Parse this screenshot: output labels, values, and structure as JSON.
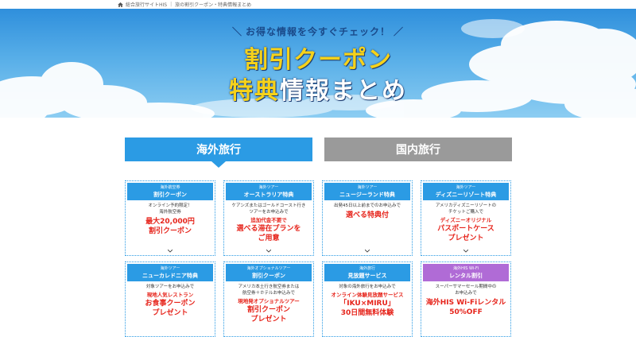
{
  "breadcrumb": {
    "home": "総合旅行サイトHIS",
    "current": "旅の割引クーポン・特典情報まとめ"
  },
  "hero": {
    "tagline": "お得な情報を今すぐチェック！",
    "title_line1": "割引クーポン",
    "title_line2_yellow": "特典",
    "title_line2_white": "情報まとめ"
  },
  "tabs": {
    "overseas": "海外旅行",
    "domestic": "国内旅行"
  },
  "cards": [
    {
      "category": "海外航空券",
      "name": "割引クーポン",
      "desc": [
        "オンライン予約限定！",
        "海外航空券"
      ],
      "highlight": [
        "最大20,000円",
        "割引クーポン"
      ]
    },
    {
      "category": "海外ツアー",
      "name": "オーストラリア特典",
      "desc": [
        "ケアンズまたはゴールドコースト行き",
        "ツアーをお申込みで"
      ],
      "highlight_small": "追加代金不要で",
      "highlight": [
        "選べる滞在プランを",
        "ご用意"
      ]
    },
    {
      "category": "海外ツアー",
      "name": "ニュージーランド特典",
      "desc": [
        "出発45日以上前までのお申込みで"
      ],
      "highlight": [
        "選べる特典付"
      ]
    },
    {
      "category": "海外ツアー",
      "name": "ディズニーリゾート特典",
      "desc": [
        "アメリカディズニーリゾートの",
        "チケットご購入で"
      ],
      "highlight_small": "ディズニーオリジナル",
      "highlight": [
        "パスポートケース",
        "プレゼント"
      ]
    },
    {
      "category": "海外ツアー",
      "name": "ニューカレドニア特典",
      "desc": [
        "対象ツアーをお申込みで"
      ],
      "highlight_small": "現地人気レストラン",
      "highlight": [
        "お食事クーポン",
        "プレゼント"
      ]
    },
    {
      "category": "海外オプショナルツアー",
      "name": "割引クーポン",
      "desc": [
        "アメリカ本土行き航空券または",
        "航空券＋ホテルお申込みで"
      ],
      "highlight_small": "現地発オプショナルツアー",
      "highlight": [
        "割引クーポン",
        "プレゼント"
      ]
    },
    {
      "category": "海外旅行",
      "name": "見放題サービス",
      "desc": [
        "対象の海外旅行をお申込みで"
      ],
      "highlight_small": "オンライン体験見放題サービス",
      "highlight": [
        "「IKU×MIRU」",
        "30日間無料体験"
      ]
    },
    {
      "category": "海外HIS Wi-Fi",
      "name": "レンタル割引",
      "desc": [
        "スーパーサマーセール期間中の",
        "お申込みで"
      ],
      "highlight": [
        "海外HIS Wi-Fiレンタル",
        "50%OFF"
      ]
    }
  ],
  "colors": {
    "accent": "#2b9be4",
    "inactive_tab": "#9a9a9a",
    "highlight_red": "#e6241b",
    "title_yellow": "#f6d21a",
    "wifi_purple": "#b06bd6"
  }
}
